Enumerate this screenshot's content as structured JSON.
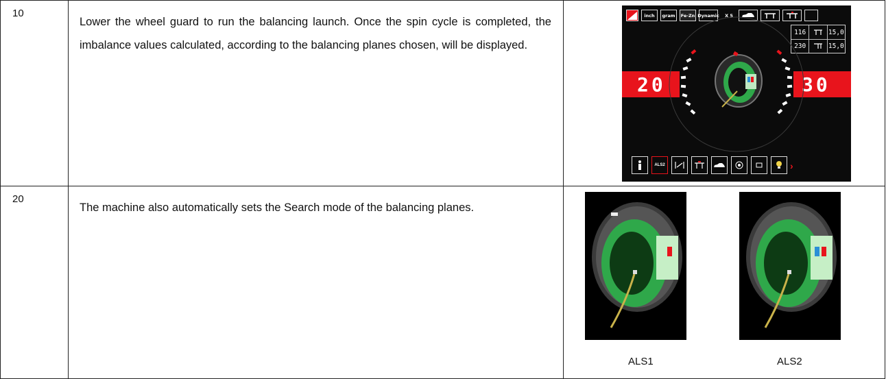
{
  "rows": [
    {
      "number": "10",
      "text": "Lower the wheel guard to run the balancing launch. Once the spin cycle is completed, the imbalance values calculated, according to the balancing planes chosen, will be displayed."
    },
    {
      "number": "20",
      "text": "The machine also automatically sets the Search mode of the balancing planes."
    }
  ],
  "screen": {
    "toolbar_labels": [
      "inch",
      "gram",
      "Fe-Zn",
      "Dynamic",
      "X 5"
    ],
    "dimensions": [
      {
        "a": "116",
        "b": "15,0"
      },
      {
        "a": "230",
        "b": "15,0"
      }
    ],
    "left_value": "20",
    "right_value": "30",
    "bottom_label": "ALS2"
  },
  "images": [
    {
      "caption": "ALS1",
      "icon": "wheel-als1-icon"
    },
    {
      "caption": "ALS2",
      "icon": "wheel-als2-icon"
    }
  ],
  "colors": {
    "accent_red": "#e8141c",
    "rim_green": "#2fa84a",
    "marker_blue": "#2b8fd6"
  }
}
